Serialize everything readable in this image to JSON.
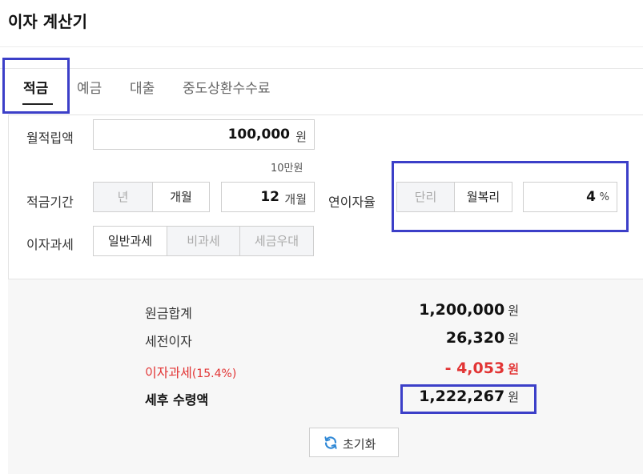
{
  "page": {
    "title": "이자 계산기"
  },
  "tabs": [
    {
      "label": "적금"
    },
    {
      "label": "예금"
    },
    {
      "label": "대출"
    },
    {
      "label": "중도상환수수료"
    }
  ],
  "form": {
    "monthly_deposit": {
      "label": "월적립액",
      "value": "100,000",
      "unit": "원",
      "hint": "10만원"
    },
    "period": {
      "label": "적금기간",
      "options": [
        "년",
        "개월"
      ],
      "selected": "개월",
      "value": "12",
      "unit": "개월"
    },
    "rate": {
      "label": "연이자율",
      "options": [
        "단리",
        "월복리"
      ],
      "selected": "월복리",
      "value": "4",
      "unit": "%"
    },
    "tax": {
      "label": "이자과세",
      "options": [
        "일반과세",
        "비과세",
        "세금우대"
      ],
      "selected": "일반과세"
    }
  },
  "results": {
    "principal": {
      "label": "원금합계",
      "value": "1,200,000",
      "unit": "원"
    },
    "pretax_interest": {
      "label": "세전이자",
      "value": "26,320",
      "unit": "원"
    },
    "tax": {
      "label": "이자과세",
      "rate": "(15.4%)",
      "value": "- 4,053",
      "unit": "원"
    },
    "net": {
      "label": "세후 수령액",
      "value": "1,222,267",
      "unit": "원"
    }
  },
  "reset_label": "초기화",
  "colors": {
    "highlight": "#3c3fc8",
    "negative": "#e23434",
    "reset_icon": "#2f88d6"
  }
}
